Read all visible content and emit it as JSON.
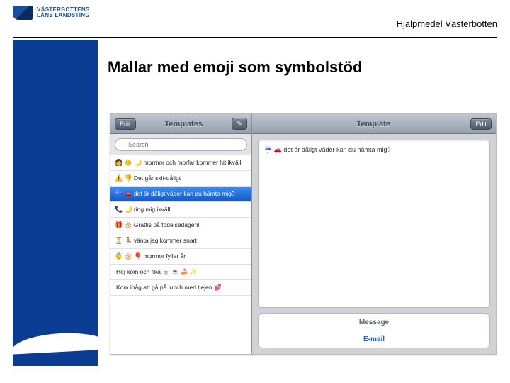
{
  "header": {
    "org_line1": "VÄSTERBOTTENS",
    "org_line2": "LÄNS LANDSTING",
    "right_text": "Hjälpmedel Västerbotten"
  },
  "title": "Mallar med emoji som symbolstöd",
  "app": {
    "left": {
      "edit_label": "Edit",
      "title": "Templates",
      "compose_label": "✎",
      "search_placeholder": "Search",
      "items": [
        {
          "emoji": "👩 👴 🌙",
          "text": "mormor och morfar kommer hit ikväll"
        },
        {
          "emoji": "⚠️ 👎",
          "text": "Det går skit-dåligt"
        },
        {
          "emoji": "☔ 🚗",
          "text": "det är dåligt väder kan du hämta mig?"
        },
        {
          "emoji": "📞 🌙",
          "text": "ring mig ikväll"
        },
        {
          "emoji": "🎁 🎂",
          "text": "Grattis på födelsedagen!"
        },
        {
          "emoji": "⏳ 🏃",
          "text": "vänta jag kommer snart"
        },
        {
          "emoji": "👵 🎂 🎈",
          "text": "mormor fyller år"
        },
        {
          "emoji": "",
          "text": "Hej kom och fika 🍵 ☕ 🍰 ✨"
        },
        {
          "emoji": "",
          "text": "Kom ihåg att gå på lunch med tjejen 💕"
        }
      ],
      "selected_index": 2
    },
    "right": {
      "title": "Template",
      "edit_label": "Edit",
      "preview": "☔ 🚗 det är dåligt väder kan du hämta mig?",
      "action_message": "Message",
      "action_email": "E-mail"
    }
  }
}
